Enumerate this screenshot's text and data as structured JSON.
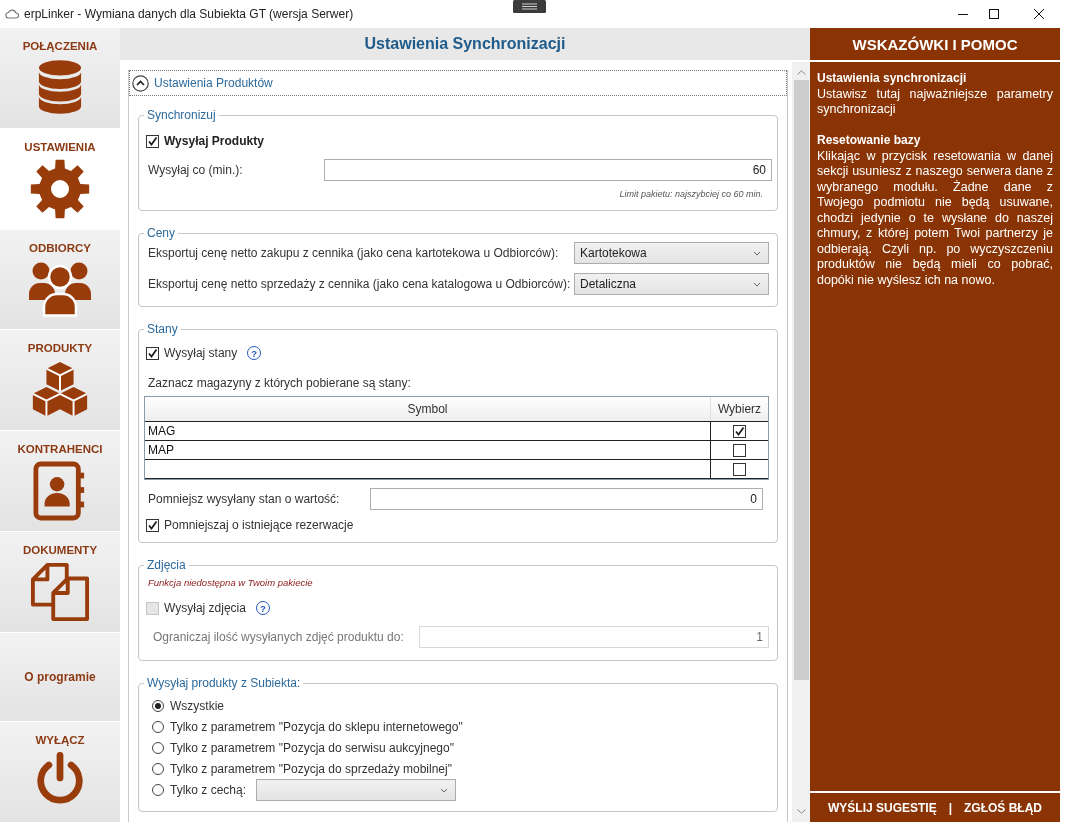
{
  "window": {
    "title": "erpLinker - Wymiana danych dla Subiekta GT (wersja Serwer)"
  },
  "sidebar": {
    "items": [
      {
        "label": "POŁĄCZENIA",
        "kind": "database",
        "selected": false
      },
      {
        "label": "USTAWIENIA",
        "kind": "gear",
        "selected": true
      },
      {
        "label": "ODBIORCY",
        "kind": "people",
        "selected": false
      },
      {
        "label": "PRODUKTY",
        "kind": "boxes",
        "selected": false
      },
      {
        "label": "KONTRAHENCI",
        "kind": "contacts",
        "selected": false
      },
      {
        "label": "DOKUMENTY",
        "kind": "documents",
        "selected": false
      },
      {
        "label": "O programie",
        "kind": "text",
        "selected": false
      },
      {
        "label": "WYŁĄCZ",
        "kind": "power",
        "selected": false
      }
    ]
  },
  "header": {
    "title": "Ustawienia Synchronizacji"
  },
  "expander": {
    "title": "Ustawienia Produktów",
    "expanded": true
  },
  "sync": {
    "legend": "Synchronizuj",
    "send_products": {
      "label": "Wysyłaj Produkty",
      "checked": true
    },
    "interval": {
      "label": "Wysyłaj co (min.):",
      "value": "60"
    },
    "hint": "Limit pakietu: najszybciej co 60 min."
  },
  "prices": {
    "legend": "Ceny",
    "rows": [
      {
        "label": "Eksportuj cenę netto zakupu z cennika (jako cena kartotekowa u Odbiorców):",
        "value": "Kartotekowa"
      },
      {
        "label": "Eksportuj cenę netto sprzedaży z cennika (jako cena katalogowa u Odbiorców):",
        "value": "Detaliczna"
      }
    ]
  },
  "stock": {
    "legend": "Stany",
    "send_stock": {
      "label": "Wysyłaj stany",
      "checked": true,
      "help": "?"
    },
    "warehouses_label": "Zaznacz magazyny z których pobierane są stany:",
    "table": {
      "columns": [
        "Symbol",
        "Wybierz"
      ],
      "rows": [
        {
          "symbol": "MAG",
          "checked": true
        },
        {
          "symbol": "MAP",
          "checked": false
        },
        {
          "checked": false
        }
      ]
    },
    "reduce": {
      "label": "Pomniejsz wysyłany stan o wartość:",
      "value": "0"
    },
    "reservations": {
      "label": "Pomniejszaj o istniejące rezerwacje",
      "checked": true
    }
  },
  "photos": {
    "legend": "Zdjęcia",
    "notice": "Funkcja niedostępna w Twoim pakiecie",
    "send_photos": {
      "label": "Wysyłaj zdjęcia",
      "checked": false,
      "disabled": true,
      "help": "?"
    },
    "limit": {
      "label": "Ograniczaj ilość wysyłanych zdjęć produktu do:",
      "value": "1",
      "disabled": true
    }
  },
  "source": {
    "legend": "Wysyłaj produkty z Subiekta:",
    "options": [
      {
        "label": "Wszystkie",
        "kind": "plain",
        "selected": true
      },
      {
        "label": "Tylko z parametrem \"Pozycja do sklepu internetowego\"",
        "kind": "plain",
        "selected": false
      },
      {
        "label": "Tylko z parametrem \"Pozycja do serwisu aukcyjnego\"",
        "kind": "plain",
        "selected": false
      },
      {
        "label": "Tylko z parametrem \"Pozycja do sprzedaży mobilnej\"",
        "kind": "plain",
        "selected": false
      },
      {
        "label": "Tylko z cechą:",
        "kind": "dropdown",
        "selected": false
      }
    ]
  },
  "help": {
    "title": "WSKAZÓWKI I POMOC",
    "sections": [
      {
        "heading": "Ustawienia synchronizacji",
        "text": "Ustawisz tutaj najważniejsze parametry synchronizacji"
      },
      {
        "heading": "Resetowanie bazy",
        "text": "Klikając w przycisk resetowania w danej sekcji usuniesz z naszego serwera dane z wybranego modułu. Żadne dane z Twojego podmiotu nie będą usuwane, chodzi jedynie o te wysłane do naszej chmury, z której potem Twoi partnerzy je odbierają. Czyli np. po wyczyszczeniu produktów nie będą mieli co pobrać, dopóki nie wyślesz ich na nowo."
      }
    ],
    "footer": {
      "links": [
        "WYŚLIJ SUGESTIĘ",
        "ZGŁOŚ BŁĄD"
      ],
      "separator": "|"
    }
  }
}
